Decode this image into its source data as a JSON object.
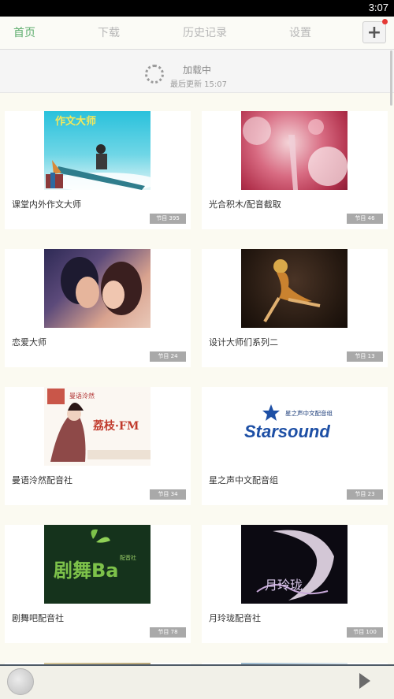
{
  "status_bar": {
    "time": "3:07"
  },
  "tabs": [
    {
      "label": "首页",
      "active": true
    },
    {
      "label": "下载",
      "active": false
    },
    {
      "label": "历史记录",
      "active": false
    },
    {
      "label": "设置",
      "active": false
    }
  ],
  "refresh": {
    "loading_text": "加载中",
    "updated_text": "最后更新 15:07"
  },
  "cards": [
    {
      "title": "课堂内外作文大师",
      "badge": "节目 395",
      "image_text": "作文大师"
    },
    {
      "title": "光合积木/配音截取",
      "badge": "节目 46"
    },
    {
      "title": "恋爱大师",
      "badge": "节目 24"
    },
    {
      "title": "设计大师们系列二",
      "badge": "节目 13"
    },
    {
      "title": "曼语泠然配音社",
      "badge": "节目 34",
      "image_text": "荔枝·FM"
    },
    {
      "title": "星之声中文配音组",
      "badge": "节目 23",
      "image_text": "Starsound",
      "image_subtext": "星之声中文配音组"
    },
    {
      "title": "剧舞吧配音社",
      "badge": "节目 78",
      "image_text": "剧舞Ba",
      "image_subtext": "配音社"
    },
    {
      "title": "月玲珑配音社",
      "badge": "节目 100"
    }
  ],
  "colors": {
    "accent": "#5fae6f",
    "badge": "#a9a9a9",
    "notification": "#e53935"
  }
}
